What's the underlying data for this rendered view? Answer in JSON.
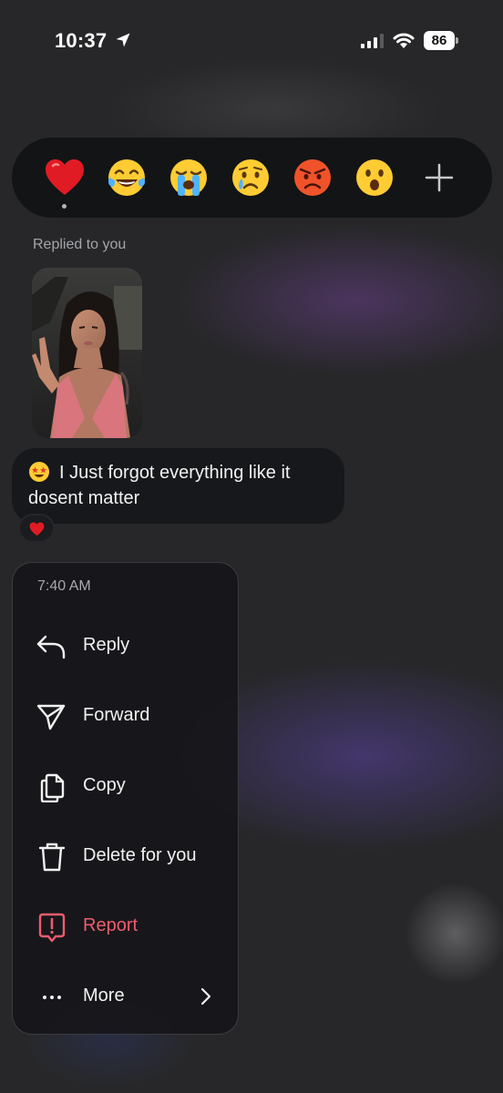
{
  "status_bar": {
    "time": "10:37",
    "battery_level": "86",
    "icons": [
      "location-arrow-icon",
      "signal-icon",
      "wifi-icon",
      "battery-icon"
    ]
  },
  "reaction_bar": {
    "reactions": [
      {
        "icon": "red-heart-emoji",
        "selected": true
      },
      {
        "icon": "tears-of-joy-emoji"
      },
      {
        "icon": "loudly-crying-emoji"
      },
      {
        "icon": "crying-face-emoji"
      },
      {
        "icon": "angry-face-emoji"
      },
      {
        "icon": "astonished-face-emoji"
      }
    ],
    "more_icon": "plus-icon"
  },
  "chat": {
    "replied_label": "Replied to you",
    "story_thumbnail_icon": "story-photo",
    "message": {
      "emoji_icon": "star-struck-emoji",
      "text": "I Just forgot everything like it dosent matter",
      "reaction_icon": "red-heart-emoji"
    }
  },
  "context_menu": {
    "timestamp": "7:40 AM",
    "items": [
      {
        "label": "Reply",
        "icon": "reply-arrow-icon"
      },
      {
        "label": "Forward",
        "icon": "send-icon"
      },
      {
        "label": "Copy",
        "icon": "copy-icon"
      },
      {
        "label": "Delete for you",
        "icon": "trash-icon"
      },
      {
        "label": "Report",
        "icon": "report-icon",
        "danger_color": "#ee5c6d"
      },
      {
        "label": "More",
        "icon": "ellipsis-icon",
        "trailing_icon": "chevron-right-icon"
      }
    ]
  },
  "colors": {
    "background": "#272729",
    "bubble": "#16181b",
    "reaction_bar": "#121416",
    "danger": "#ee5c6d",
    "secondary_text": "#a4a5aa"
  }
}
